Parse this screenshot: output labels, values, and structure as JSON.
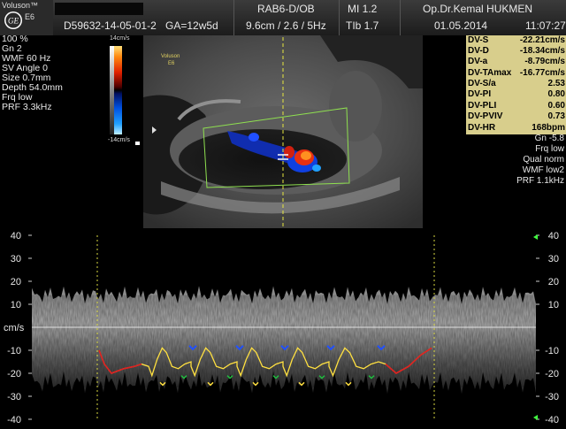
{
  "header": {
    "brand": "Voluson™",
    "model": "E6",
    "logo": "GE",
    "patient_id": "D59632-14-05-01-2",
    "ga": "GA=12w5d",
    "probe_mode": "RAB6-D/OB",
    "depth_freq": "9.6cm / 2.6 / 5Hz",
    "mi": "MI  1.2",
    "tib": "TIb  1.7",
    "operator": "Op.Dr.Kemal HUKMEN",
    "date": "01.05.2014",
    "time": "11:07:27"
  },
  "left_params": [
    "100 %",
    "Gn  2",
    "WMF 60 Hz",
    "SV Angle  0",
    "Size  0.7mm",
    "Depth 54.0mm",
    "Frq low",
    "PRF  3.3kHz"
  ],
  "color_bar": {
    "top_label": "14cm/s",
    "bottom_label": "-14cm/s"
  },
  "image_watermark": [
    "Voluson",
    "E6"
  ],
  "measurements": [
    {
      "label": "DV-S",
      "value": "-22.21cm/s"
    },
    {
      "label": "DV-D",
      "value": "-18.34cm/s"
    },
    {
      "label": "DV-a",
      "value": "-8.79cm/s"
    },
    {
      "label": "DV-TAmax",
      "value": "-16.77cm/s"
    },
    {
      "label": "DV-S/a",
      "value": "2.53"
    },
    {
      "label": "DV-PI",
      "value": "0.80"
    },
    {
      "label": "DV-PLI",
      "value": "0.60"
    },
    {
      "label": "DV-PVIV",
      "value": "0.73"
    },
    {
      "label": "DV-HR",
      "value": "168bpm"
    }
  ],
  "right_params": [
    "Gn -5.8",
    "Frq low",
    "Qual norm",
    "WMF low2",
    "PRF  1.1kHz"
  ],
  "spectral": {
    "unit": "cm/s",
    "ticks": [
      40,
      30,
      20,
      10,
      -10,
      -20,
      -30,
      -40
    ],
    "range": [
      -40,
      40
    ]
  },
  "colors": {
    "measure_bg": "#d8ce8c",
    "trace_yellow": "#ffe040",
    "trace_red": "#e02020",
    "marker_blue": "#2050ff",
    "marker_green": "#20c040",
    "guide_green": "#9fe070"
  }
}
